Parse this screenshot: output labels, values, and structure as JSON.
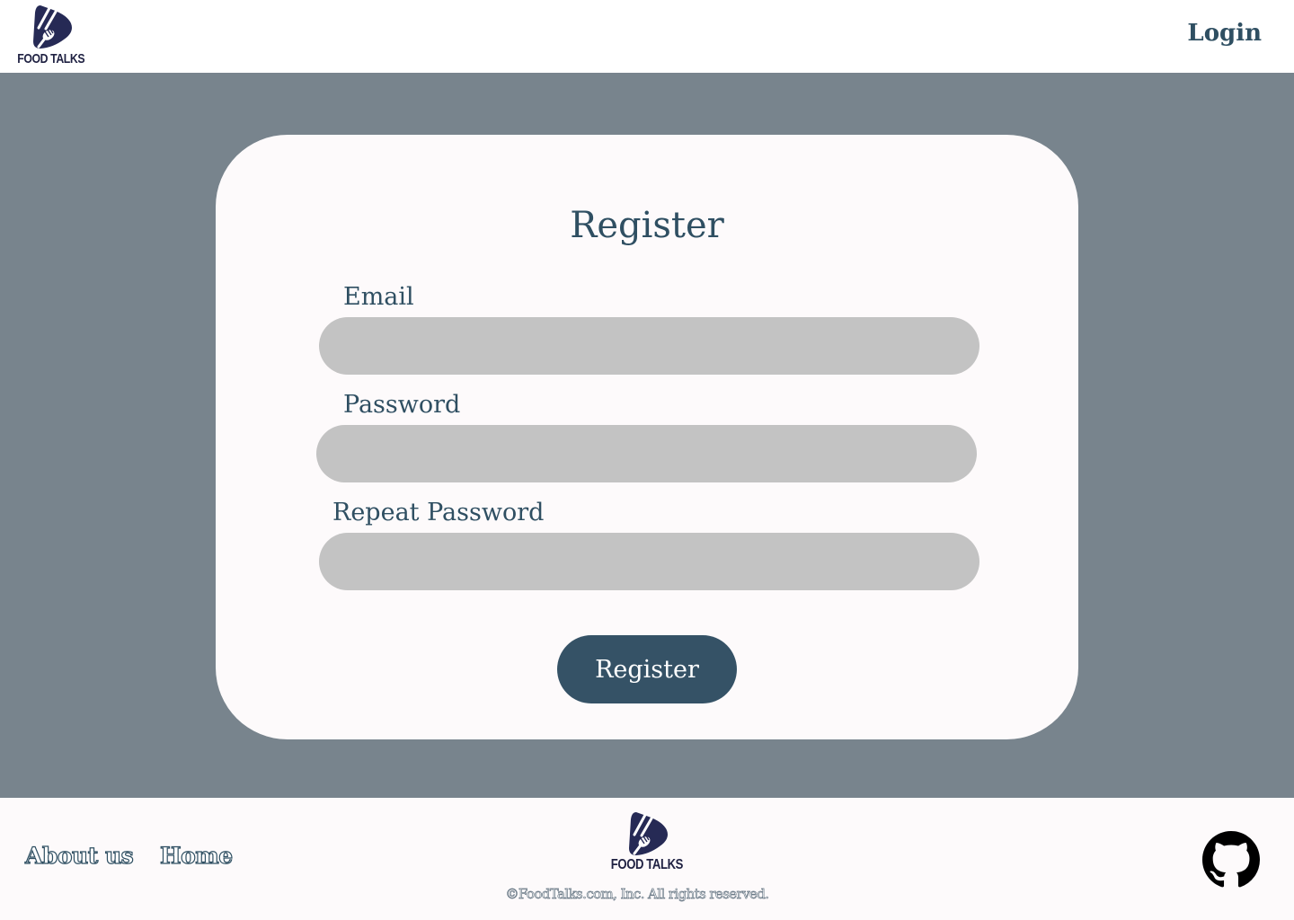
{
  "header": {
    "logo_text": "FOOD TALKS",
    "login_label": "Login"
  },
  "form": {
    "title": "Register",
    "email_label": "Email",
    "email_value": "",
    "password_label": "Password",
    "password_value": "",
    "repeat_password_label": "Repeat Password",
    "repeat_password_value": "",
    "submit_label": "Register"
  },
  "footer": {
    "about_label": "About us",
    "home_label": "Home",
    "logo_text": "FOOD TALKS",
    "copyright": "©FoodTalks.com, Inc. All rights reserved.",
    "github_icon": "github-icon"
  },
  "colors": {
    "background": "#78848d",
    "card": "#fdfafb",
    "text_primary": "#2f4f62",
    "input": "#c3c3c3",
    "button": "#355266",
    "logo": "#1f2142"
  }
}
